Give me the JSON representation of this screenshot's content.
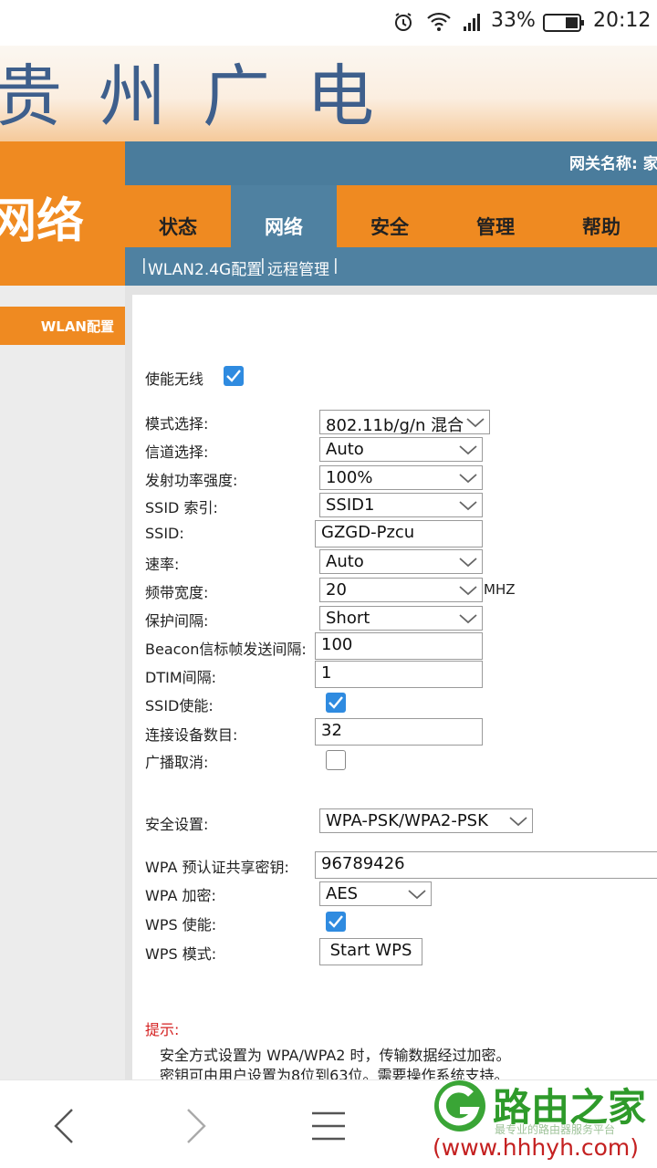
{
  "status_bar": {
    "battery": "33%",
    "time": "20:12"
  },
  "banner": {
    "logo_text": "贵州广电"
  },
  "section_title": "网络",
  "gateway": {
    "label": "网关名称: 家"
  },
  "tabs": [
    {
      "label": "状态"
    },
    {
      "label": "网络"
    },
    {
      "label": "安全"
    },
    {
      "label": "管理"
    },
    {
      "label": "帮助"
    }
  ],
  "subnav": [
    {
      "label": "WLAN2.4G配置"
    },
    {
      "label": "远程管理"
    }
  ],
  "sidebar": {
    "menu_item": "WLAN配置"
  },
  "form": {
    "enable_wireless": {
      "label": "使能无线",
      "checked": true
    },
    "mode": {
      "label": "模式选择:",
      "value": "802.11b/g/n 混合"
    },
    "channel": {
      "label": "信道选择:",
      "value": "Auto"
    },
    "tx_power": {
      "label": "发射功率强度:",
      "value": "100%"
    },
    "ssid_index": {
      "label": "SSID 索引:",
      "value": "SSID1"
    },
    "ssid": {
      "label": "SSID:",
      "value": "GZGD-Pzcu"
    },
    "rate": {
      "label": "速率:",
      "value": "Auto"
    },
    "bandwidth": {
      "label": "频带宽度:",
      "value": "20",
      "unit": "MHZ"
    },
    "guard_interval": {
      "label": "保护间隔:",
      "value": "Short"
    },
    "beacon": {
      "label": "Beacon信标帧发送间隔:",
      "value": "100"
    },
    "dtim": {
      "label": "DTIM间隔:",
      "value": "1"
    },
    "ssid_enable": {
      "label": "SSID使能:",
      "checked": true
    },
    "max_devices": {
      "label": "连接设备数目:",
      "value": "32"
    },
    "broadcast_cancel": {
      "label": "广播取消:",
      "checked": false
    },
    "security": {
      "label": "安全设置:",
      "value": "WPA-PSK/WPA2-PSK"
    },
    "psk": {
      "label": "WPA 预认证共享密钥:",
      "value": "96789426"
    },
    "wpa_encryption": {
      "label": "WPA 加密:",
      "value": "AES"
    },
    "wps_enable": {
      "label": "WPS 使能:",
      "checked": true
    },
    "wps_mode": {
      "label": "WPS 模式:",
      "button": "Start WPS"
    }
  },
  "tip": {
    "title": "提示:",
    "lines": [
      "安全方式设置为 WPA/WPA2 时，传输数据经过加密。",
      "密钥可由用户设置为8位到63位。需要操作系统支持。"
    ]
  },
  "watermark": {
    "brand": "路由之家",
    "url": "(www.hhhyh.com)",
    "sub": "最专业的路由器服务平台"
  },
  "colors": {
    "orange": "#ef8a21",
    "blue": "#4f81a1",
    "checkbox": "#2f8be0",
    "tip_red": "#d42020"
  }
}
